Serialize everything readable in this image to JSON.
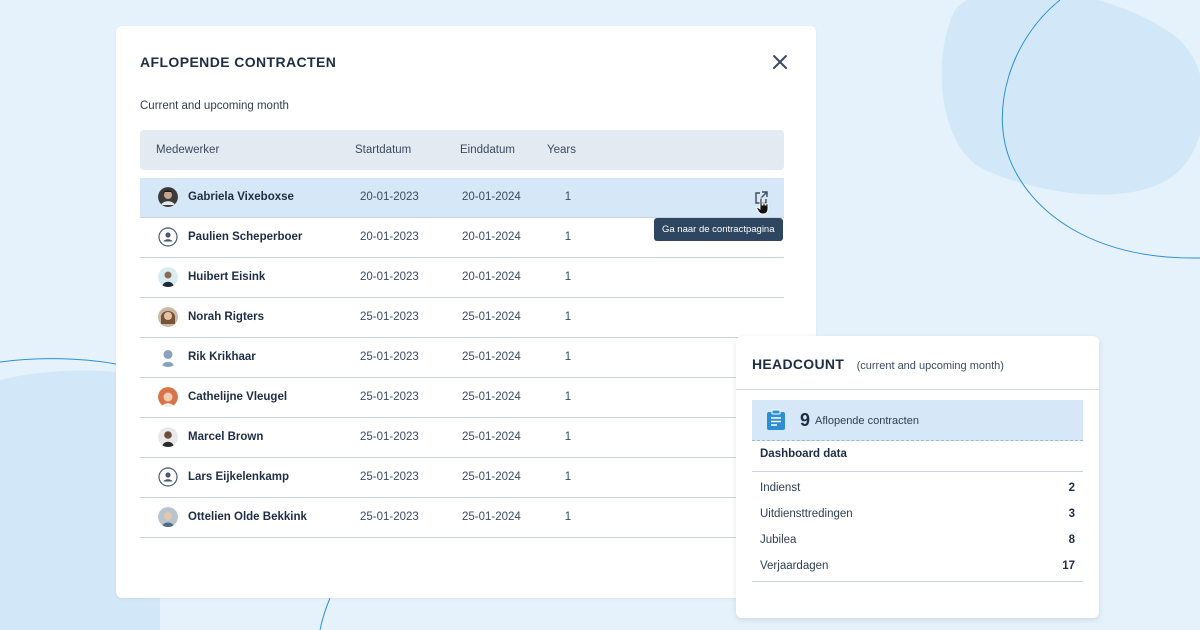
{
  "colors": {
    "accent": "#2f4661",
    "highlight": "#d6e8f7",
    "background": "#e6f2fb",
    "icon_blue": "#2c8fd6"
  },
  "contracts": {
    "title": "AFLOPENDE CONTRACTEN",
    "subtitle": "Current and upcoming month",
    "close_icon": "close-icon",
    "columns": [
      "Medewerker",
      "Startdatum",
      "Einddatum",
      "Years"
    ],
    "rows": [
      {
        "name": "Gabriela Vixeboxse",
        "start": "20-01-2023",
        "end": "20-01-2024",
        "years": "1",
        "avatar": "photo"
      },
      {
        "name": "Paulien Scheperboer",
        "start": "20-01-2023",
        "end": "20-01-2024",
        "years": "1",
        "avatar": "placeholder-user-icon"
      },
      {
        "name": "Huibert Eisink",
        "start": "20-01-2023",
        "end": "20-01-2024",
        "years": "1",
        "avatar": "photo"
      },
      {
        "name": "Norah Rigters",
        "start": "25-01-2023",
        "end": "25-01-2024",
        "years": "1",
        "avatar": "photo"
      },
      {
        "name": "Rik Krikhaar",
        "start": "25-01-2023",
        "end": "25-01-2024",
        "years": "1",
        "avatar": "photo"
      },
      {
        "name": "Cathelijne Vleugel",
        "start": "25-01-2023",
        "end": "25-01-2024",
        "years": "1",
        "avatar": "photo"
      },
      {
        "name": "Marcel Brown",
        "start": "25-01-2023",
        "end": "25-01-2024",
        "years": "1",
        "avatar": "photo"
      },
      {
        "name": "Lars Eijkelenkamp",
        "start": "25-01-2023",
        "end": "25-01-2024",
        "years": "1",
        "avatar": "placeholder-user-icon"
      },
      {
        "name": "Ottelien Olde Bekkink",
        "start": "25-01-2023",
        "end": "25-01-2024",
        "years": "1",
        "avatar": "photo"
      }
    ],
    "tooltip": "Ga naar de contractpagina",
    "row_action_icon": "external-link-icon"
  },
  "headcount": {
    "title": "HEADCOUNT",
    "subtitle": "(current and upcoming month)",
    "kpi": {
      "icon": "clipboard-icon",
      "value": "9",
      "label": "Aflopende contracten"
    },
    "dashboard_title": "Dashboard data",
    "items": [
      {
        "label": "Indienst",
        "value": "2"
      },
      {
        "label": "Uitdiensttredingen",
        "value": "3"
      },
      {
        "label": "Jubilea",
        "value": "8"
      },
      {
        "label": "Verjaardagen",
        "value": "17"
      }
    ]
  }
}
